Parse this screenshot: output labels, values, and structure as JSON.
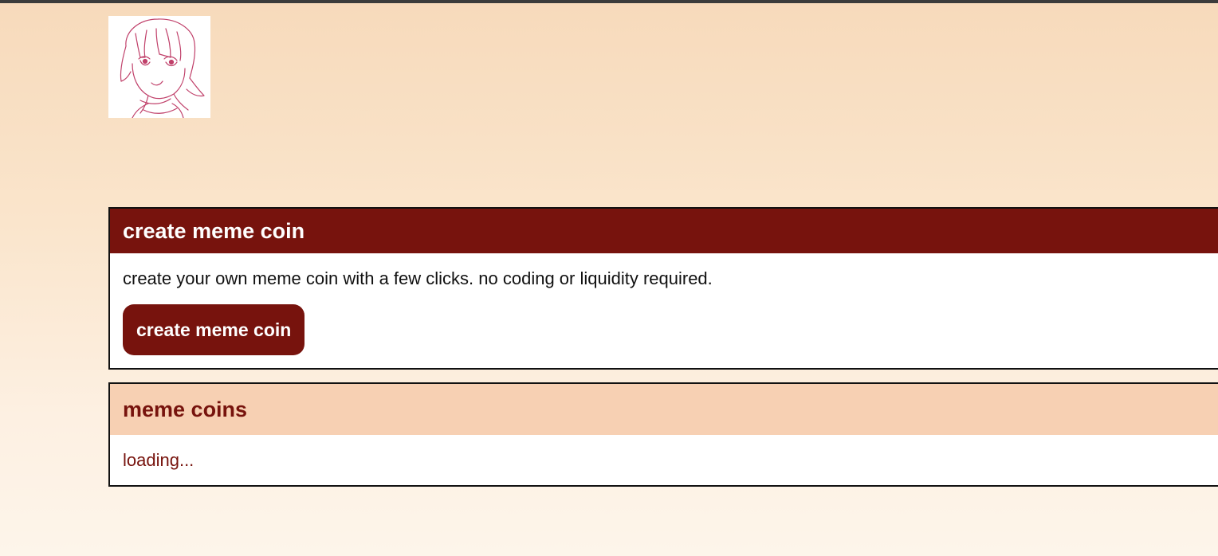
{
  "create_panel": {
    "title": "create meme coin",
    "description": "create your own meme coin with a few clicks. no coding or liquidity required.",
    "button_label": "create meme coin"
  },
  "coins_panel": {
    "title": "meme coins",
    "status": "loading..."
  },
  "colors": {
    "brand": "#77130d",
    "header_light": "#f7d0b3",
    "background_top": "#f7dabb",
    "background_bottom": "#fdf5ea",
    "logo_line": "#c0406a"
  },
  "icons": {
    "logo": "anime-girl-sketch-logo"
  }
}
